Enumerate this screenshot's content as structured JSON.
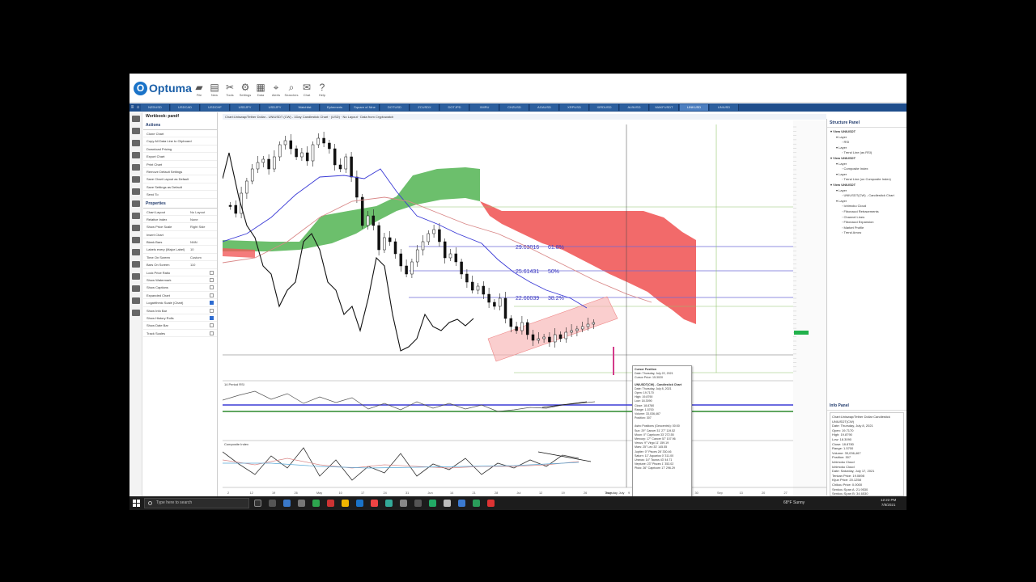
{
  "app": {
    "name": "Optuma"
  },
  "ribbon": {
    "buttons": [
      {
        "label": "File",
        "icon": "folder-icon"
      },
      {
        "label": "New",
        "icon": "new-icon"
      },
      {
        "label": "Tools",
        "icon": "tools-icon"
      },
      {
        "label": "Settings",
        "icon": "settings-icon"
      },
      {
        "label": "Data",
        "icon": "data-icon"
      },
      {
        "label": "Alerts",
        "icon": "alerts-icon"
      },
      {
        "label": "Searches",
        "icon": "searches-icon"
      },
      {
        "label": "Chat",
        "icon": "chat-icon"
      },
      {
        "label": "Help",
        "icon": "help-icon"
      }
    ]
  },
  "tabs": [
    "NZDUSD",
    "USDCAD",
    "USDCHF",
    "USDJPY",
    "USDJPY",
    "Watchlist",
    "Ephemeris",
    "Square of Nine",
    "DOTUSD",
    "ZCUSDX",
    "DOTJPD",
    "XMRU",
    "CHZUSD",
    "AGAUSD",
    "XRPUSD",
    "XIRDUSD",
    "ALBUSD",
    "MAKFUSDT",
    "LINKUSD",
    "UNIUSD"
  ],
  "active_tab_index": 18,
  "left_panel": {
    "workbook": "Workbook: pandf",
    "actions_header": "Actions",
    "actions": [
      "Clone Chart",
      "Copy All Data Line to Clipboard",
      "Download Pricing",
      "Export Chart",
      "Print Chart",
      "Remove Default Settings",
      "Save Chart Layout as Default",
      "Save Settings as Default",
      "Send To"
    ],
    "properties_header": "Properties",
    "properties": [
      {
        "label": "Chart Layout",
        "value": "No Layout",
        "check": null
      },
      {
        "label": "Relative Index",
        "value": "None",
        "check": null
      },
      {
        "label": "Show Price Scale",
        "value": "Right Side",
        "check": null
      },
      {
        "label": "Insert Chart",
        "value": "",
        "check": null
      },
      {
        "label": "Blank Bars",
        "value": "NNN",
        "check": null
      },
      {
        "label": "Labels every (Major Label)",
        "value": "10",
        "check": null
      },
      {
        "label": "Time On Screen",
        "value": "Custom",
        "check": null
      },
      {
        "label": "Bars On Screen",
        "value": "110",
        "check": null
      },
      {
        "label": "Lock Price Ratio",
        "value": "",
        "check": false
      },
      {
        "label": "Show Watermark",
        "value": "",
        "check": false
      },
      {
        "label": "Show Captions",
        "value": "",
        "check": false
      },
      {
        "label": "Expanded Chart",
        "value": "",
        "check": false
      },
      {
        "label": "Logarithmic Scale (Chart)",
        "value": "",
        "check": true
      },
      {
        "label": "Show Info Bar",
        "value": "",
        "check": false
      },
      {
        "label": "Show History Rolls",
        "value": "",
        "check": true
      },
      {
        "label": "Show Date Bar",
        "value": "",
        "check": false
      },
      {
        "label": "Track Scales",
        "value": "",
        "check": false
      }
    ]
  },
  "chart": {
    "title": "Chart:Uniswap/Tether  Dollar - UNIUSDT (CW) - 1Day Candlestick Chart  ·  (USD) · No Layout · Data from Cryptowatch",
    "fib_labels": [
      {
        "price": "29.03016",
        "pct": "61.8%"
      },
      {
        "price": "25.61431",
        "pct": "50%"
      },
      {
        "price": "22.60039",
        "pct": "38.2%"
      }
    ],
    "panel2_title": "14 Period RSI",
    "panel3_title": "Composite Index",
    "x_labels": [
      "2",
      "12",
      "19",
      "26",
      "May",
      "10",
      "17",
      "24",
      "31",
      "Jun",
      "14",
      "21",
      "28",
      "Jul",
      "12",
      "19",
      "26",
      "Aug",
      "9",
      "16",
      "23",
      "30",
      "Sep",
      "13",
      "20",
      "27"
    ],
    "crosshair_date": "Thursday, July",
    "colors": {
      "bull_cloud": "#5cb85c",
      "bear_cloud": "#f15a5a",
      "channel": "#f7b3b3",
      "kijun": "#3b3bd6",
      "tenkan": "#d98888"
    }
  },
  "popup": {
    "title": "Cursor Position",
    "lines": [
      "Date: Thursday, July 22, 2021",
      "Cursor Price: 15.3020"
    ],
    "section": "UNIUSDT(CW) - Candlestick Chart",
    "detail": [
      "Date: Thursday, July 8, 2021",
      "Open: 19.7170",
      "High: 19.8790",
      "Low: 18.3090",
      "Close: 18.8780",
      "Range: 1.5700",
      "Volume: 33,036,467",
      "Position: 307"
    ],
    "astro_title": "Astro Positions (Geocentric): 00:00",
    "astro": [
      "Sun: 29° Cancer 31' 27\" 119.52",
      "Moon: 0° Capricorn 33' 272.55",
      "Mercury: 17° Cancer 57' 107.96",
      "Venus: 9° Virgo 11' 159.19",
      "Mars: 25° Leo 33' 145.55",
      "Jupiter: 0° Pisces 28' 330.46",
      "Saturn: 11° Aquarius 0' 311.00",
      "Uranus: 14° Taurus 43' 44.71",
      "Neptune: 23° Pisces 1' 353.02",
      "Pluto: 26° Capricorn 17' 296.29"
    ]
  },
  "right_panel": {
    "structure_title": "Structure Panel",
    "tree": [
      {
        "level": 0,
        "text": "View  UNIUSDT"
      },
      {
        "level": 1,
        "text": "Layer"
      },
      {
        "level": 2,
        "text": "RSI"
      },
      {
        "level": 1,
        "text": "Layer"
      },
      {
        "level": 2,
        "text": "Trend Line (as RSI)"
      },
      {
        "level": 0,
        "text": "View  UNIUSDT"
      },
      {
        "level": 1,
        "text": "Layer"
      },
      {
        "level": 2,
        "text": "Composite Index"
      },
      {
        "level": 1,
        "text": "Layer"
      },
      {
        "level": 2,
        "text": "Trend Line (on Composite Index)"
      },
      {
        "level": 0,
        "text": "View  UNIUSDT"
      },
      {
        "level": 1,
        "text": "Layer"
      },
      {
        "level": 2,
        "text": "UNIUSDT(CW) - Candlestick Chart"
      },
      {
        "level": 1,
        "text": "Layer"
      },
      {
        "level": 2,
        "text": "Ichimoku Cloud"
      },
      {
        "level": 2,
        "text": "Fibonacci Retracements"
      },
      {
        "level": 2,
        "text": "Channel Lines"
      },
      {
        "level": 2,
        "text": "Fibonacci Expansion"
      },
      {
        "level": 2,
        "text": "Market Profile"
      },
      {
        "level": 2,
        "text": "Trend Arrow"
      }
    ],
    "info_title": "Info Panel",
    "info": [
      "Chart:Uniswap/Tether Dollar Candlestick",
      "UNIUSDT(CW)",
      "Date: Thursday, July 8, 2021",
      "Open: 19.7170",
      "High: 19.8790",
      "Low: 18.3090",
      "Close: 18.8780",
      "Range: 1.5700",
      "Volume: 33,036,467",
      "Position: 307",
      "",
      "Ichimoku Cloud",
      "Ichimoku Cloud",
      "Date: Saturday, July 17, 2021",
      "Tenkan Price: 19.0898",
      "Kijun Price: 20.1258",
      "Chikou Price: 0.0000",
      "Senkou Span A: 21.9530",
      "Senkou Span B: 34.6530"
    ]
  },
  "taskbar": {
    "search_placeholder": "Type here to search",
    "weather": "68°F  Sunny",
    "time": "12:22 PM",
    "date": "7/8/2021"
  }
}
